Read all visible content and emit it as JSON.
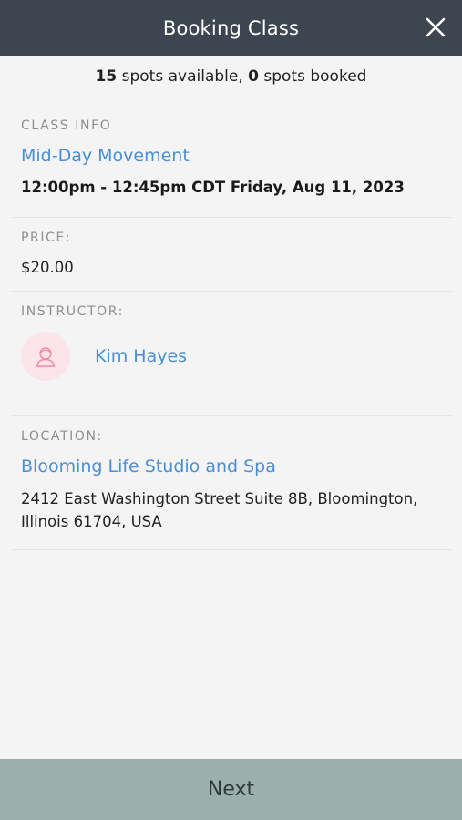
{
  "header": {
    "title": "Booking Class"
  },
  "spots": {
    "available_count": "15",
    "available_text": " spots available, ",
    "booked_count": "0",
    "booked_text": " spots booked"
  },
  "class_info": {
    "label": "CLASS INFO",
    "name": "Mid-Day Movement",
    "time": "12:00pm - 12:45pm CDT Friday, Aug 11, 2023"
  },
  "price": {
    "label": "PRICE:",
    "value": "$20.00"
  },
  "instructor": {
    "label": "INSTRUCTOR:",
    "name": "Kim Hayes",
    "avatar_icon": "person-icon"
  },
  "location": {
    "label": "LOCATION:",
    "name": "Blooming Life Studio and Spa",
    "address_line1": "2412 East Washington Street Suite 8B, Bloomington,",
    "address_line2": "Illinois 61704, USA"
  },
  "footer": {
    "next_label": "Next"
  },
  "colors": {
    "header_bg": "#3d4650",
    "link": "#4a8fd6",
    "footer_bg": "#9cb0ab",
    "avatar_bg": "#fbe4ea",
    "avatar_icon": "#f08aa6"
  }
}
